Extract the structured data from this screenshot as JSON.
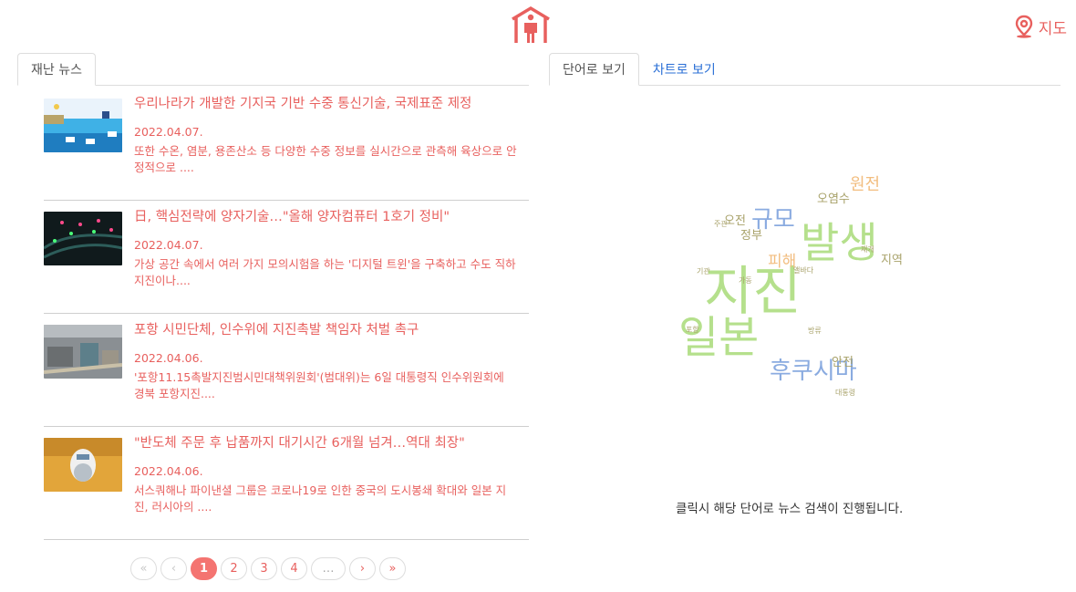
{
  "header": {
    "map_label": "지도"
  },
  "colors": {
    "accent": "#e8605e",
    "active_page": "#f47471",
    "link": "#2a6fd6"
  },
  "left_tabs": [
    "재난 뉴스"
  ],
  "right_tabs": [
    "단어로 보기",
    "차트로 보기"
  ],
  "news": [
    {
      "title": "우리나라가 개발한 기지국 기반 수중 통신기술, 국제표준 제정",
      "date": "2022.04.07.",
      "summary": "또한 수온, 염분, 용존산소 등 다양한 수중 정보를 실시간으로 관측해 육상으로 안정적으로 ...."
    },
    {
      "title": "日, 핵심전략에 양자기술…\"올해 양자컴퓨터 1호기 정비\"",
      "date": "2022.04.07.",
      "summary": "가상 공간 속에서 여러 가지 모의시험을 하는 '디지털 트윈'을 구축하고 수도 직하 지진이나...."
    },
    {
      "title": "포항 시민단체, 인수위에 지진촉발 책임자 처벌 촉구",
      "date": "2022.04.06.",
      "summary": "'포항11.15촉발지진범시민대책위원회'(범대위)는 6일 대통령직 인수위원회에 경북 포항지진...."
    },
    {
      "title": "\"반도체 주문 후 납품까지 대기시간 6개월 넘겨…역대 최장\"",
      "date": "2022.04.06.",
      "summary": "서스쿼해나 파이낸셜 그룹은 코로나19로 인한 중국의 도시봉쇄 확대와 일본 지진, 러시아의 ...."
    }
  ],
  "pagination": {
    "first": "«",
    "prev": "‹",
    "pages": [
      "1",
      "2",
      "3",
      "4"
    ],
    "active": "1",
    "ellipsis": "…",
    "next": "›",
    "last": "»"
  },
  "word_cloud": [
    {
      "word": "지진",
      "color": "#b5e08c"
    },
    {
      "word": "발생",
      "color": "#b5e08c"
    },
    {
      "word": "일본",
      "color": "#b5e08c"
    },
    {
      "word": "후쿠시마",
      "color": "#8aabe0"
    },
    {
      "word": "규모",
      "color": "#8aabe0"
    },
    {
      "word": "원전",
      "color": "#f2bd7f"
    },
    {
      "word": "피해",
      "color": "#f2bd7f"
    },
    {
      "word": "오염수",
      "color": "#a8a26a"
    },
    {
      "word": "지역",
      "color": "#a8a26a"
    },
    {
      "word": "오전",
      "color": "#a8a26a"
    },
    {
      "word": "정부",
      "color": "#a8a26a"
    },
    {
      "word": "안전",
      "color": "#a8a26a"
    },
    {
      "word": "주관",
      "color": "#a8a26a"
    },
    {
      "word": "기관",
      "color": "#a8a26a"
    },
    {
      "word": "가동",
      "color": "#a8a26a"
    },
    {
      "word": "앨바다",
      "color": "#a8a26a"
    },
    {
      "word": "재개",
      "color": "#a8a26a"
    },
    {
      "word": "포항",
      "color": "#a8a26a"
    },
    {
      "word": "방류",
      "color": "#a8a26a"
    },
    {
      "word": "대통령",
      "color": "#a8a26a"
    }
  ],
  "hint": "클릭시 해당 단어로 뉴스 검색이 진행됩니다."
}
